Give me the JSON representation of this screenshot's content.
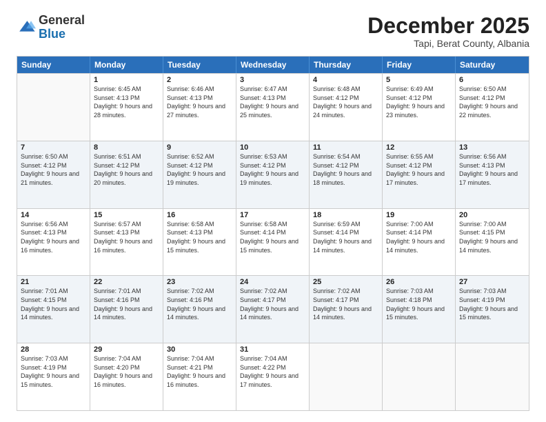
{
  "logo": {
    "general": "General",
    "blue": "Blue"
  },
  "title": "December 2025",
  "subtitle": "Tapi, Berat County, Albania",
  "days_of_week": [
    "Sunday",
    "Monday",
    "Tuesday",
    "Wednesday",
    "Thursday",
    "Friday",
    "Saturday"
  ],
  "weeks": [
    [
      {
        "day": "",
        "empty": true,
        "sunrise": "",
        "sunset": "",
        "daylight": ""
      },
      {
        "day": "1",
        "empty": false,
        "sunrise": "6:45 AM",
        "sunset": "4:13 PM",
        "daylight": "9 hours and 28 minutes."
      },
      {
        "day": "2",
        "empty": false,
        "sunrise": "6:46 AM",
        "sunset": "4:13 PM",
        "daylight": "9 hours and 27 minutes."
      },
      {
        "day": "3",
        "empty": false,
        "sunrise": "6:47 AM",
        "sunset": "4:13 PM",
        "daylight": "9 hours and 25 minutes."
      },
      {
        "day": "4",
        "empty": false,
        "sunrise": "6:48 AM",
        "sunset": "4:12 PM",
        "daylight": "9 hours and 24 minutes."
      },
      {
        "day": "5",
        "empty": false,
        "sunrise": "6:49 AM",
        "sunset": "4:12 PM",
        "daylight": "9 hours and 23 minutes."
      },
      {
        "day": "6",
        "empty": false,
        "sunrise": "6:50 AM",
        "sunset": "4:12 PM",
        "daylight": "9 hours and 22 minutes."
      }
    ],
    [
      {
        "day": "7",
        "empty": false,
        "sunrise": "6:50 AM",
        "sunset": "4:12 PM",
        "daylight": "9 hours and 21 minutes."
      },
      {
        "day": "8",
        "empty": false,
        "sunrise": "6:51 AM",
        "sunset": "4:12 PM",
        "daylight": "9 hours and 20 minutes."
      },
      {
        "day": "9",
        "empty": false,
        "sunrise": "6:52 AM",
        "sunset": "4:12 PM",
        "daylight": "9 hours and 19 minutes."
      },
      {
        "day": "10",
        "empty": false,
        "sunrise": "6:53 AM",
        "sunset": "4:12 PM",
        "daylight": "9 hours and 19 minutes."
      },
      {
        "day": "11",
        "empty": false,
        "sunrise": "6:54 AM",
        "sunset": "4:12 PM",
        "daylight": "9 hours and 18 minutes."
      },
      {
        "day": "12",
        "empty": false,
        "sunrise": "6:55 AM",
        "sunset": "4:12 PM",
        "daylight": "9 hours and 17 minutes."
      },
      {
        "day": "13",
        "empty": false,
        "sunrise": "6:56 AM",
        "sunset": "4:13 PM",
        "daylight": "9 hours and 17 minutes."
      }
    ],
    [
      {
        "day": "14",
        "empty": false,
        "sunrise": "6:56 AM",
        "sunset": "4:13 PM",
        "daylight": "9 hours and 16 minutes."
      },
      {
        "day": "15",
        "empty": false,
        "sunrise": "6:57 AM",
        "sunset": "4:13 PM",
        "daylight": "9 hours and 16 minutes."
      },
      {
        "day": "16",
        "empty": false,
        "sunrise": "6:58 AM",
        "sunset": "4:13 PM",
        "daylight": "9 hours and 15 minutes."
      },
      {
        "day": "17",
        "empty": false,
        "sunrise": "6:58 AM",
        "sunset": "4:14 PM",
        "daylight": "9 hours and 15 minutes."
      },
      {
        "day": "18",
        "empty": false,
        "sunrise": "6:59 AM",
        "sunset": "4:14 PM",
        "daylight": "9 hours and 14 minutes."
      },
      {
        "day": "19",
        "empty": false,
        "sunrise": "7:00 AM",
        "sunset": "4:14 PM",
        "daylight": "9 hours and 14 minutes."
      },
      {
        "day": "20",
        "empty": false,
        "sunrise": "7:00 AM",
        "sunset": "4:15 PM",
        "daylight": "9 hours and 14 minutes."
      }
    ],
    [
      {
        "day": "21",
        "empty": false,
        "sunrise": "7:01 AM",
        "sunset": "4:15 PM",
        "daylight": "9 hours and 14 minutes."
      },
      {
        "day": "22",
        "empty": false,
        "sunrise": "7:01 AM",
        "sunset": "4:16 PM",
        "daylight": "9 hours and 14 minutes."
      },
      {
        "day": "23",
        "empty": false,
        "sunrise": "7:02 AM",
        "sunset": "4:16 PM",
        "daylight": "9 hours and 14 minutes."
      },
      {
        "day": "24",
        "empty": false,
        "sunrise": "7:02 AM",
        "sunset": "4:17 PM",
        "daylight": "9 hours and 14 minutes."
      },
      {
        "day": "25",
        "empty": false,
        "sunrise": "7:02 AM",
        "sunset": "4:17 PM",
        "daylight": "9 hours and 14 minutes."
      },
      {
        "day": "26",
        "empty": false,
        "sunrise": "7:03 AM",
        "sunset": "4:18 PM",
        "daylight": "9 hours and 15 minutes."
      },
      {
        "day": "27",
        "empty": false,
        "sunrise": "7:03 AM",
        "sunset": "4:19 PM",
        "daylight": "9 hours and 15 minutes."
      }
    ],
    [
      {
        "day": "28",
        "empty": false,
        "sunrise": "7:03 AM",
        "sunset": "4:19 PM",
        "daylight": "9 hours and 15 minutes."
      },
      {
        "day": "29",
        "empty": false,
        "sunrise": "7:04 AM",
        "sunset": "4:20 PM",
        "daylight": "9 hours and 16 minutes."
      },
      {
        "day": "30",
        "empty": false,
        "sunrise": "7:04 AM",
        "sunset": "4:21 PM",
        "daylight": "9 hours and 16 minutes."
      },
      {
        "day": "31",
        "empty": false,
        "sunrise": "7:04 AM",
        "sunset": "4:22 PM",
        "daylight": "9 hours and 17 minutes."
      },
      {
        "day": "",
        "empty": true,
        "sunrise": "",
        "sunset": "",
        "daylight": ""
      },
      {
        "day": "",
        "empty": true,
        "sunrise": "",
        "sunset": "",
        "daylight": ""
      },
      {
        "day": "",
        "empty": true,
        "sunrise": "",
        "sunset": "",
        "daylight": ""
      }
    ]
  ]
}
